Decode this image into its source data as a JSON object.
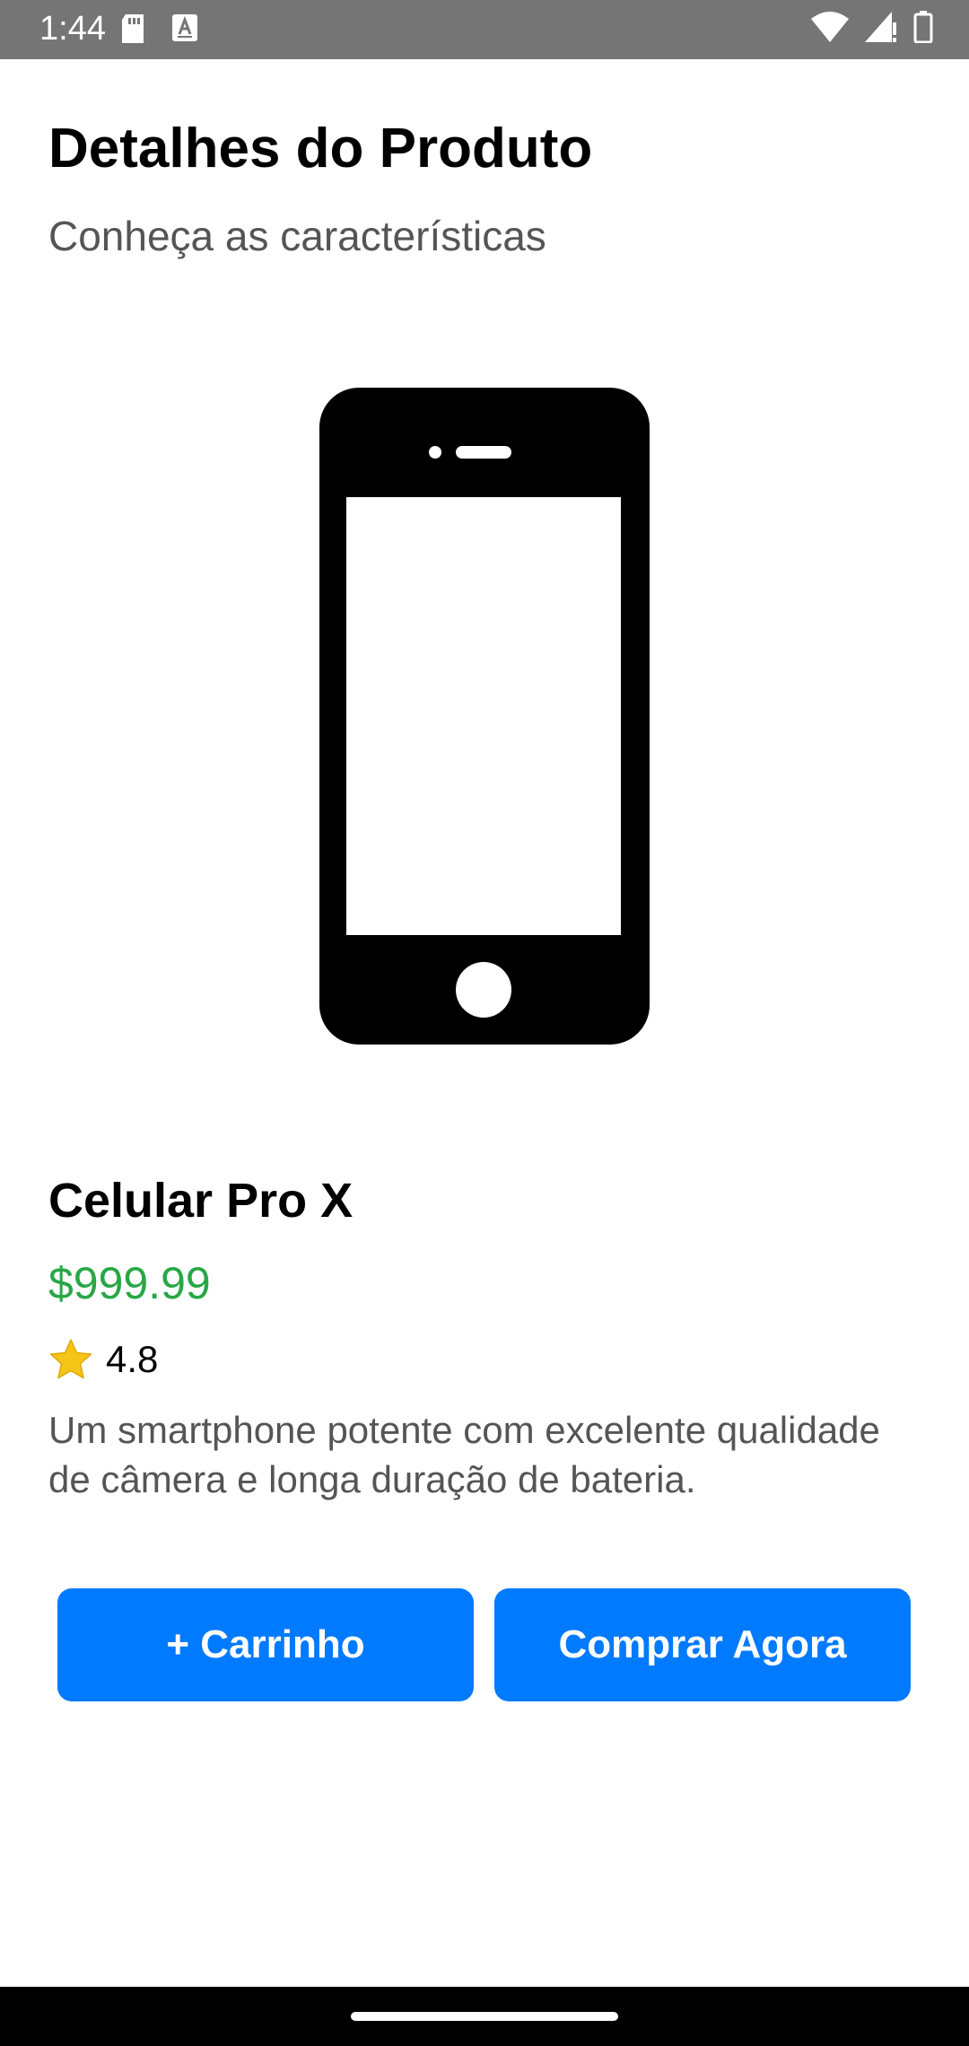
{
  "status_bar": {
    "time": "1:44",
    "left_icons": [
      "sd-card-icon",
      "font-a-icon"
    ],
    "right_icons": [
      "wifi-icon",
      "cell-signal-icon",
      "battery-icon"
    ]
  },
  "header": {
    "title": "Detalhes do Produto",
    "subtitle": "Conheça as características"
  },
  "product": {
    "image_icon": "smartphone-icon",
    "name": "Celular Pro X",
    "price": "$999.99",
    "rating_icon": "star-icon",
    "rating": "4.8",
    "description": "Um smartphone potente com excelente qualidade de câmera e longa duração de bateria."
  },
  "actions": {
    "add_to_cart_label": "+ Carrinho",
    "buy_now_label": "Comprar Agora"
  },
  "colors": {
    "status_bar": "#757575",
    "price": "#28a745",
    "button": "#007aff",
    "subtitle_text": "#555555",
    "star": "#f5c518"
  }
}
